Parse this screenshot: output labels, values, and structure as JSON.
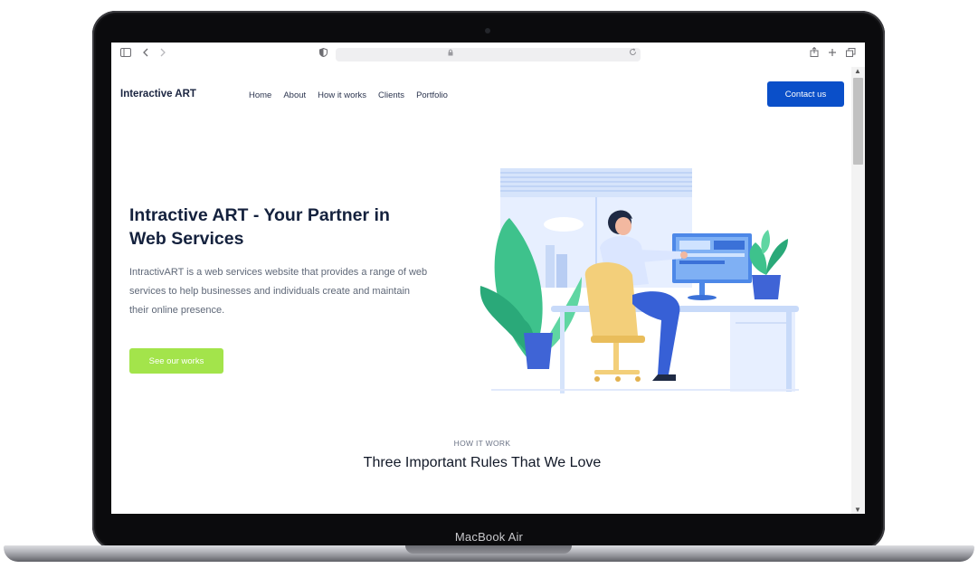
{
  "device": {
    "label": "MacBook Air"
  },
  "browser": {
    "icons": {
      "sidebar": "sidebar-icon",
      "back": "back-icon",
      "forward": "forward-icon",
      "shield": "shield-icon",
      "lock": "lock-icon",
      "reload": "reload-icon",
      "share": "share-icon",
      "new_tab": "plus-icon",
      "tabs": "tabs-icon"
    }
  },
  "header": {
    "logo": "Interactive ART",
    "nav": [
      "Home",
      "About",
      "How it works",
      "Clients",
      "Portfolio"
    ],
    "cta": "Contact us"
  },
  "hero": {
    "title": "Intractive ART - Your Partner in Web Services",
    "description": "IntractivART is a web services website that provides a range of web services to help businesses and individuals create and maintain their online presence.",
    "button": "See our works"
  },
  "section": {
    "kicker": "HOW IT WORK",
    "title": "Three Important Rules That We Love"
  },
  "colors": {
    "primary": "#0a4fc9",
    "accent_green": "#a3e44b",
    "heading": "#14213d"
  }
}
